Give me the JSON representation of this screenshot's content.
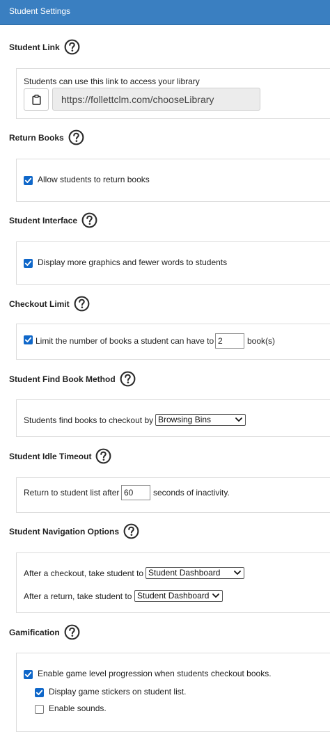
{
  "header": {
    "title": "Student Settings"
  },
  "student_link": {
    "title": "Student Link",
    "description": "Students can use this link to access your library",
    "url": "https://follettclm.com/chooseLibrary"
  },
  "return_books": {
    "title": "Return Books",
    "allow_label": "Allow students to return books",
    "allow_checked": true
  },
  "student_interface": {
    "title": "Student Interface",
    "graphics_label": "Display more graphics and fewer words to students",
    "graphics_checked": true
  },
  "checkout_limit": {
    "title": "Checkout Limit",
    "limit_label": "Limit the number of books a student can have to",
    "limit_value": "2",
    "unit": "book(s)",
    "limit_checked": true
  },
  "find_book_method": {
    "title": "Student Find Book Method",
    "label": "Students find books to checkout by",
    "selected": "Browsing Bins"
  },
  "idle_timeout": {
    "title": "Student Idle Timeout",
    "label_before": "Return to student list after",
    "seconds": "60",
    "label_after": "seconds of inactivity."
  },
  "navigation_options": {
    "title": "Student Navigation Options",
    "after_checkout_label": "After a checkout, take student to",
    "after_checkout_selected": "Student Dashboard",
    "after_return_label": "After a return, take student to",
    "after_return_selected": "Student Dashboard"
  },
  "gamification": {
    "title": "Gamification",
    "progression_label": "Enable game level progression when students checkout books.",
    "progression_checked": true,
    "stickers_label": "Display game stickers on student list.",
    "stickers_checked": true,
    "sounds_label": "Enable sounds.",
    "sounds_checked": false
  },
  "colors": {
    "header": "#3a7fc1",
    "checkbox": "#0f67c9"
  }
}
